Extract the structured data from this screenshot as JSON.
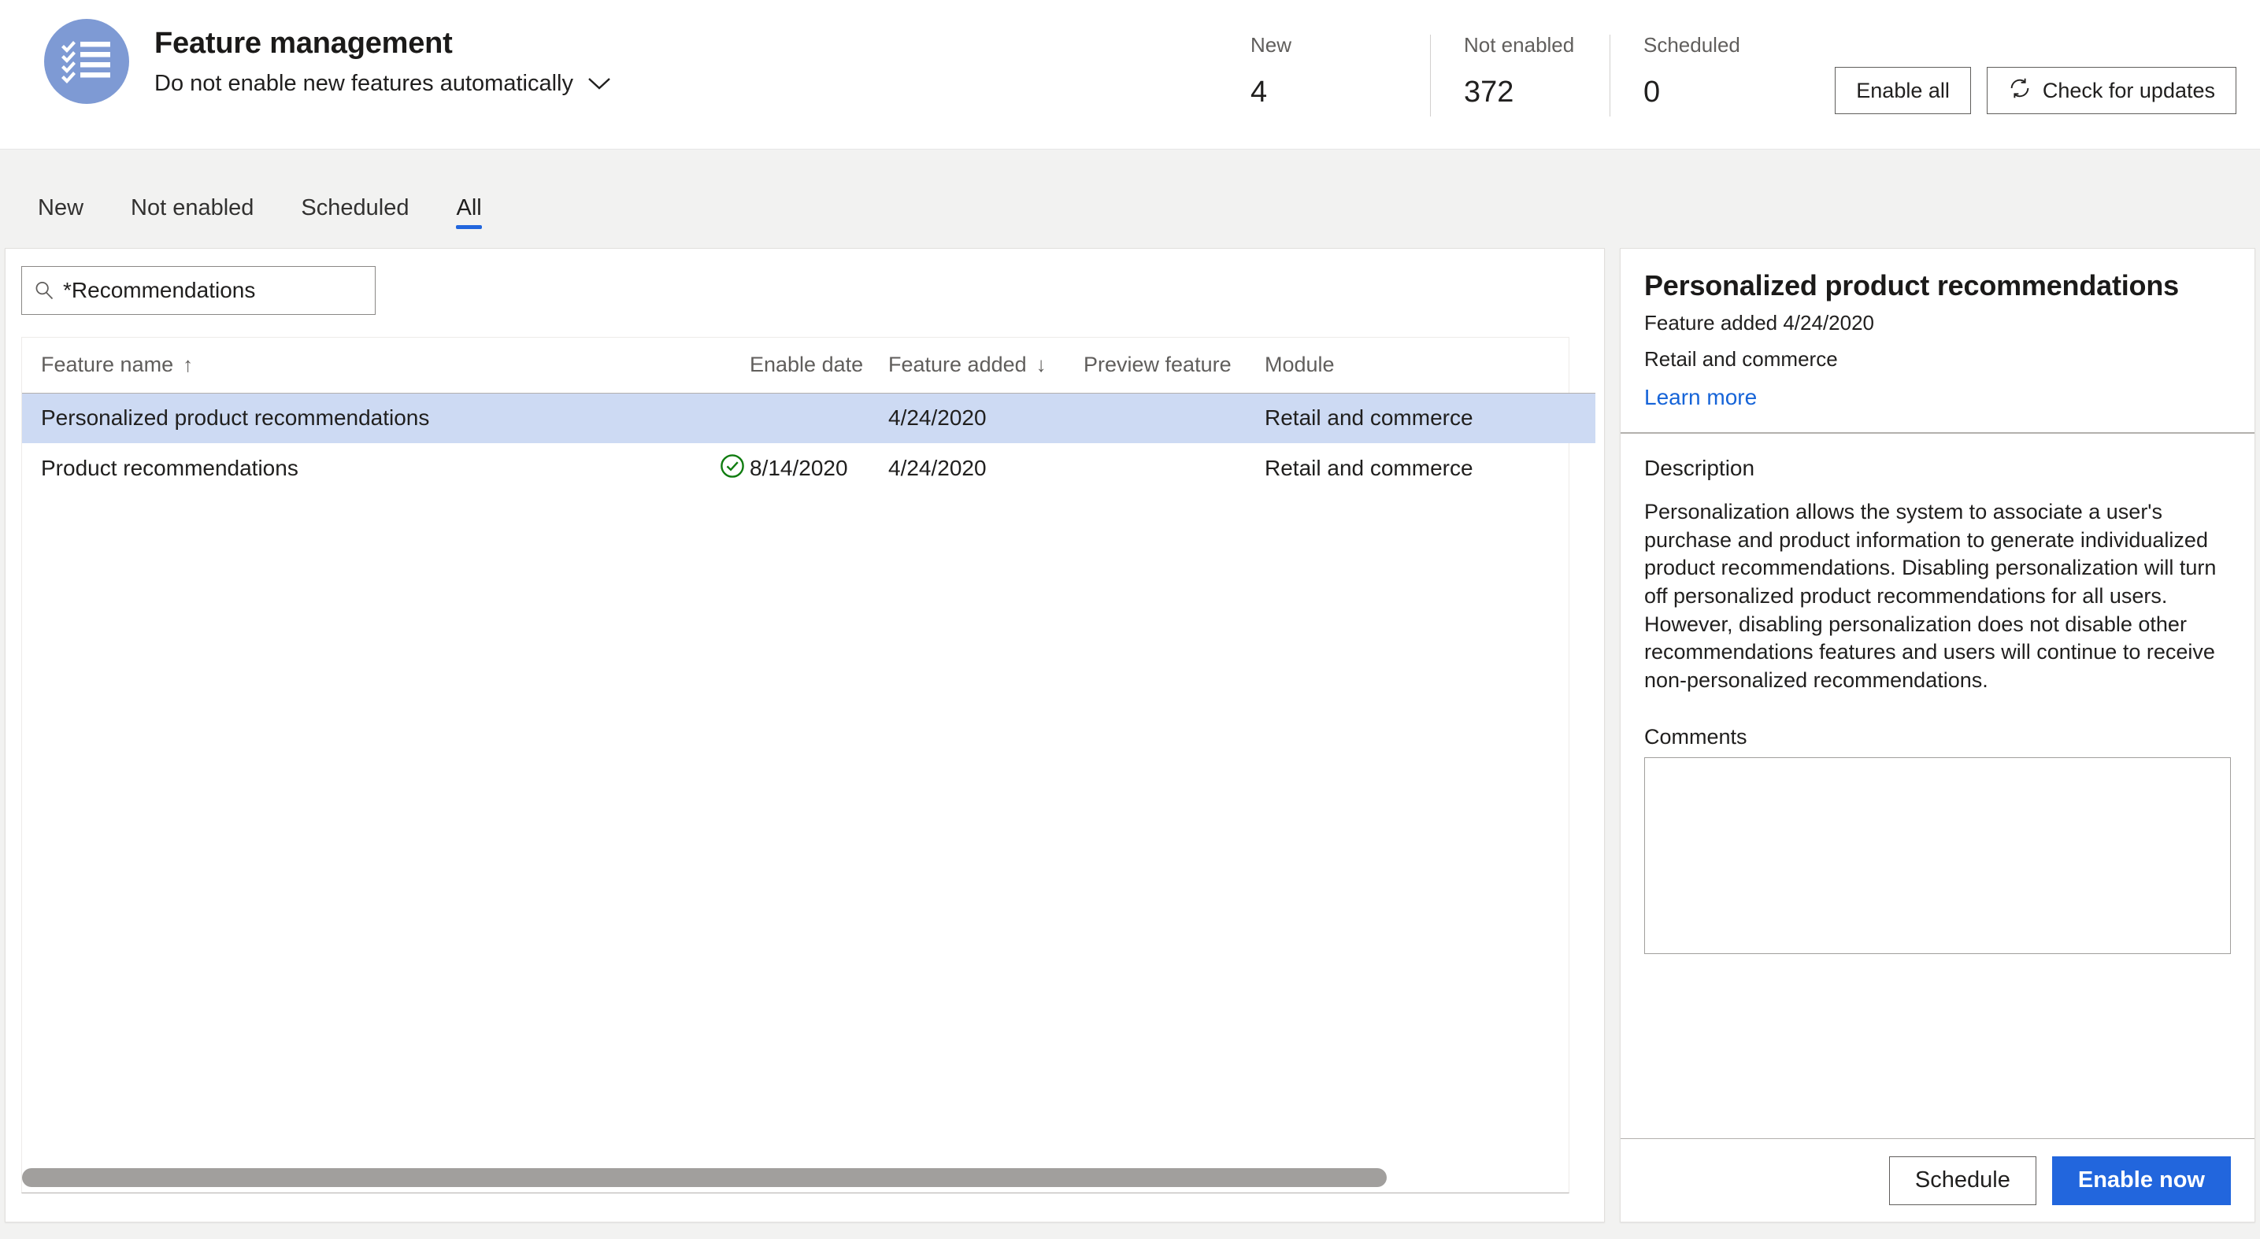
{
  "header": {
    "app_icon": "checklist-icon",
    "title": "Feature management",
    "subtitle": "Do not enable new features automatically",
    "subtitle_chevron": "chevron-down-icon",
    "stats": [
      {
        "label": "New",
        "value": "4"
      },
      {
        "label": "Not enabled",
        "value": "372"
      },
      {
        "label": "Scheduled",
        "value": "0"
      }
    ],
    "actions": {
      "enable_all": "Enable all",
      "check_updates": "Check for updates",
      "check_updates_icon": "refresh-icon"
    }
  },
  "tabs": [
    {
      "label": "New",
      "active": false
    },
    {
      "label": "Not enabled",
      "active": false
    },
    {
      "label": "Scheduled",
      "active": false
    },
    {
      "label": "All",
      "active": true
    }
  ],
  "list": {
    "search": {
      "icon": "search-icon",
      "value": "*Recommendations",
      "placeholder": "Filter"
    },
    "columns": [
      {
        "key": "name",
        "label": "Feature name",
        "sort": "↑"
      },
      {
        "key": "status",
        "label": ""
      },
      {
        "key": "enable_date",
        "label": "Enable date",
        "sort": ""
      },
      {
        "key": "feature_added",
        "label": "Feature added",
        "sort": "↓"
      },
      {
        "key": "preview_feature",
        "label": "Preview feature",
        "sort": ""
      },
      {
        "key": "module",
        "label": "Module",
        "sort": ""
      }
    ],
    "rows": [
      {
        "name": "Personalized product recommendations",
        "status_icon": "",
        "enable_date": "",
        "feature_added": "4/24/2020",
        "preview_feature": "",
        "module": "Retail and commerce",
        "selected": true
      },
      {
        "name": "Product recommendations",
        "status_icon": "check-circle-icon",
        "enable_date": "8/14/2020",
        "feature_added": "4/24/2020",
        "preview_feature": "",
        "module": "Retail and commerce",
        "selected": false
      }
    ],
    "scrollbar": "horizontal-scrollbar"
  },
  "detail": {
    "title": "Personalized product recommendations",
    "added": "Feature added 4/24/2020",
    "module": "Retail and commerce",
    "learn_more": "Learn more",
    "description_label": "Description",
    "description": "Personalization allows the system to associate a user's purchase and product information to generate individualized product recommendations. Disabling personalization will turn off personalized product recommendations for all users. However, disabling personalization does not disable other recommendations features and users will continue to receive non-personalized recommendations.",
    "comments_label": "Comments",
    "comments_value": "",
    "comments_placeholder": "",
    "footer": {
      "schedule": "Schedule",
      "enable_now": "Enable now"
    }
  },
  "colors": {
    "accent": "#2266dd",
    "selected_row": "#cddaf3",
    "icon_bg": "#7e9ad4",
    "success": "#107c10",
    "link": "#1664d8",
    "page_bg": "#f2f2f1"
  }
}
